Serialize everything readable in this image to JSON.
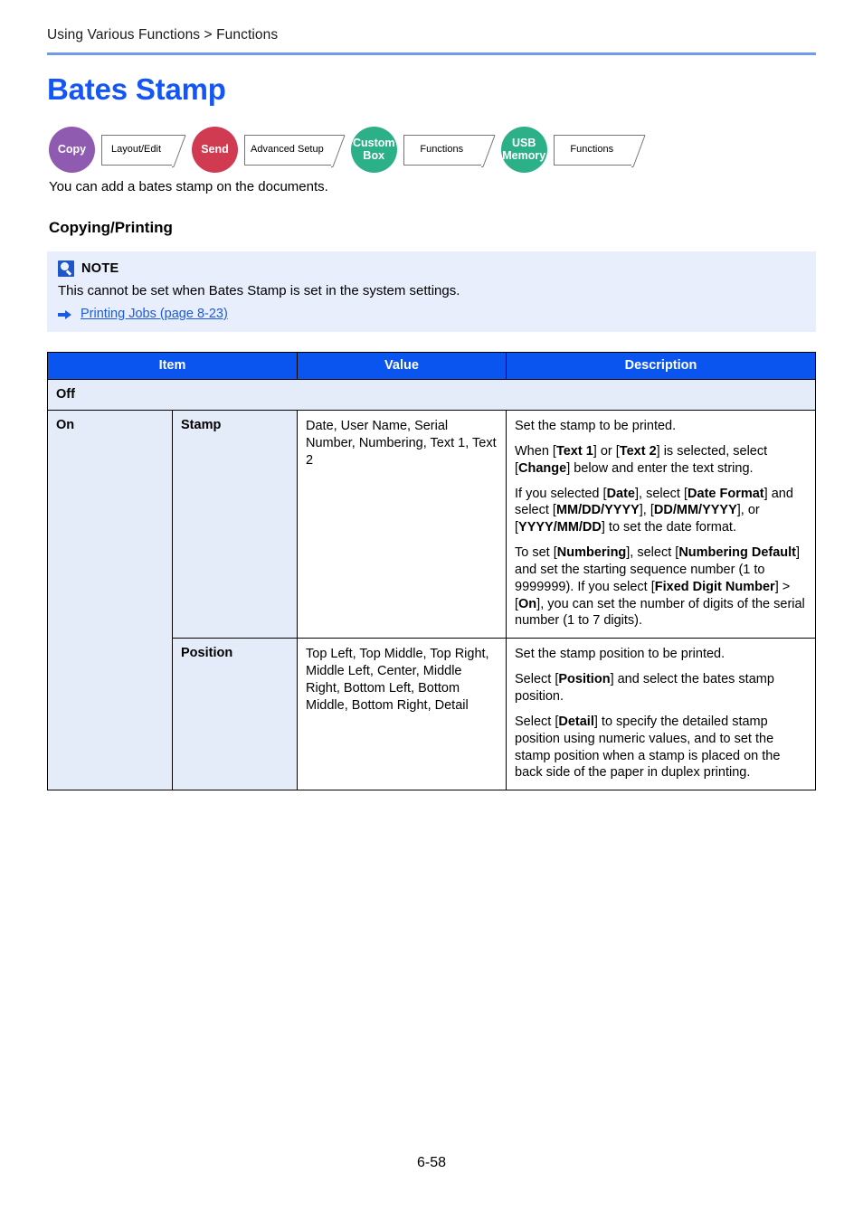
{
  "header": {
    "breadcrumb": "Using Various Functions > Functions"
  },
  "title": "Bates Stamp",
  "function_modes": [
    {
      "circle_label": "Copy",
      "circle_color": "#8f5bb0",
      "tab_label": "Layout/Edit",
      "icon": "copy-mode-circle"
    },
    {
      "circle_label": "Send",
      "circle_color": "#d13b52",
      "tab_label": "Advanced Setup",
      "icon": "send-mode-circle"
    },
    {
      "circle_label": "Custom Box",
      "circle_color": "#2cb088",
      "tab_label": "Functions",
      "icon": "custom-box-mode-circle"
    },
    {
      "circle_label": "USB Memory",
      "circle_color": "#2cb088",
      "tab_label": "Functions",
      "icon": "usb-memory-mode-circle"
    }
  ],
  "intro": "You can add a bates stamp on the documents.",
  "section_heading": "Copying/Printing",
  "note": {
    "icon": "note-info-icon",
    "title": "NOTE",
    "text": "This cannot be set when Bates Stamp is set in the system settings.",
    "arrow_icon": "right-arrow-icon",
    "link_text": "Printing Jobs (page 8-23)"
  },
  "table": {
    "headers": {
      "item": "Item",
      "value": "Value",
      "description": "Description"
    },
    "rows": {
      "off": {
        "label": "Off"
      },
      "on": {
        "label": "On",
        "stamp": {
          "sub_label": "Stamp",
          "value": "Date, User Name, Serial Number, Numbering, Text 1, Text 2",
          "description": [
            "Set the stamp to be printed.",
            "When [Text 1] or [Text 2] is selected, select [Change] below and enter the text string.",
            "If you selected [Date], select [Date Format] and select [MM/DD/YYYY], [DD/MM/YYYY], or [YYYY/MM/DD] to set the date format.",
            "To set [Numbering], select [Numbering Default] and set the starting sequence number (1 to 9999999). If you select [Fixed Digit Number] > [On], you can set the number of digits of the serial number (1 to 7 digits)."
          ]
        },
        "position": {
          "sub_label": "Position",
          "value": "Top Left, Top Middle, Top Right, Middle Left, Center, Middle Right, Bottom Left, Bottom Middle, Bottom Right, Detail",
          "description": [
            "Set the stamp position to be printed.",
            "Select [Position] and select the bates stamp position.",
            "Select [Detail] to specify the detailed stamp position using numeric values, and to set the stamp position when a stamp is placed on the back side of the paper in duplex printing."
          ]
        }
      }
    }
  },
  "footer": {
    "page_number": "6-58"
  },
  "colors": {
    "title_blue": "#1355f5",
    "rule_blue": "#6f9ce8",
    "table_header_blue": "#0a55ef",
    "cell_shade": "#e4ebf9",
    "note_bg": "#e8eefb",
    "link_blue": "#1a5ce0"
  }
}
